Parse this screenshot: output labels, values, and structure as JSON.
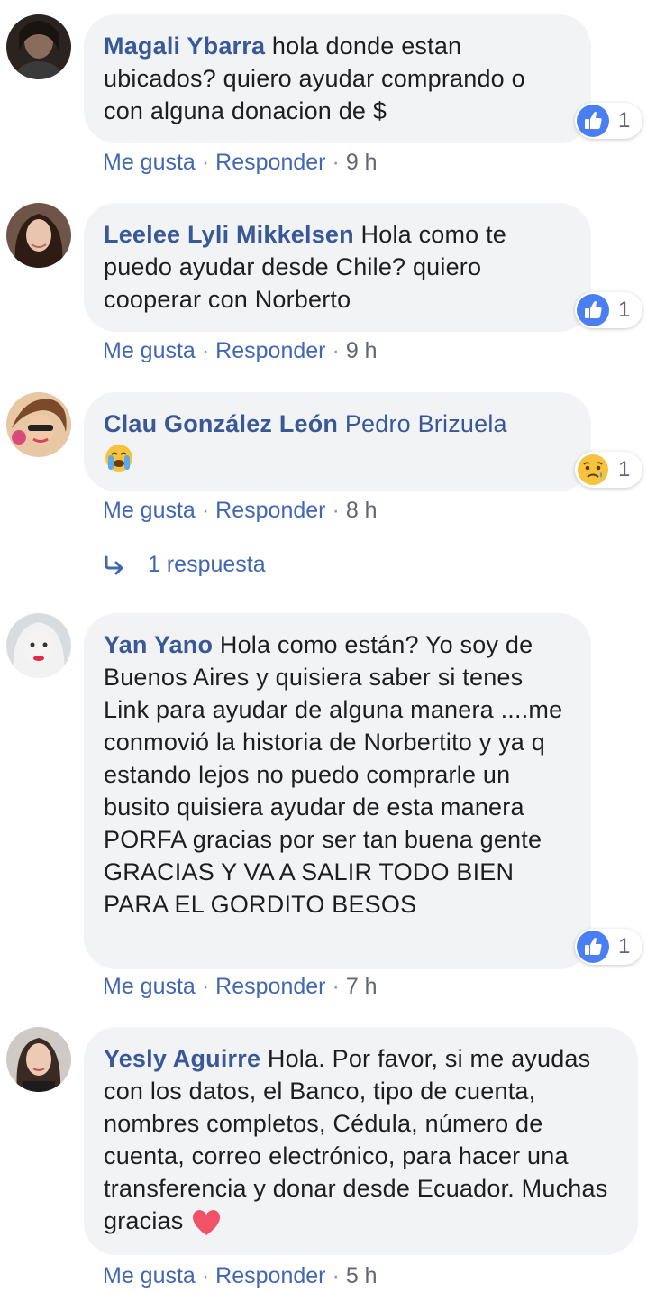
{
  "labels": {
    "like": "Me gusta",
    "reply": "Responder",
    "separator": "·"
  },
  "comments": [
    {
      "author": "Magali Ybarra",
      "text": "hola donde estan ubicados? quiero ayudar comprando o con alguna donacion de $",
      "time": "9 h",
      "reaction": {
        "icon": "like-icon",
        "count": "1"
      }
    },
    {
      "author": "Leelee Lyli Mikkelsen",
      "text": "Hola como te puedo ayudar desde Chile? quiero cooperar con Norberto",
      "time": "9 h",
      "reaction": {
        "icon": "like-icon",
        "count": "1"
      }
    },
    {
      "author": "Clau González León",
      "mention": "Pedro Brizuela",
      "emoji": "loudly-crying-face-emoji",
      "time": "8 h",
      "reaction": {
        "icon": "sad-reaction-icon",
        "count": "1"
      },
      "replies_label": "1 respuesta"
    },
    {
      "author": "Yan Yano",
      "text": "Hola como están? Yo soy de Buenos Aires y quisiera saber si tenes Link para ayudar de alguna manera ....me conmovió la historia de Norbertito y ya q estando lejos no puedo comprarle un busito quisiera ayudar de esta manera PORFA gracias por ser tan buena gente GRACIAS Y VA A SALIR TODO BIEN PARA EL GORDITO BESOS",
      "time": "7 h",
      "reaction": {
        "icon": "like-icon",
        "count": "1"
      }
    },
    {
      "author": "Yesly Aguirre",
      "text": "Hola. Por favor, si me ayudas con los datos, el Banco, tipo de cuenta, nombres completos, Cédula, número de cuenta, correo electrónico, para hacer una transferencia y donar desde Ecuador. Muchas gracias",
      "emoji": "heart-emoji",
      "time": "5 h"
    }
  ],
  "colors": {
    "link": "#385898",
    "meta_link": "#4267b2",
    "bubble": "#f2f3f5",
    "like_blue": "#4a7ef3",
    "heart": "#f25268"
  }
}
